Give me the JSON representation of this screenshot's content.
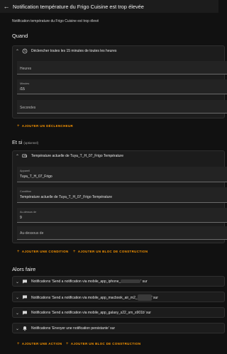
{
  "header": {
    "title": "Notification température du Frigo Cuisine est trop élevée"
  },
  "description": "Notification température du Frigo Cuisine est trop élevé",
  "quand": {
    "title": "Quand",
    "trigger": {
      "label": "Déclencher toutes les 15 minutes de toutes les heures",
      "hours_placeholder": "Heures",
      "minutes_label": "Minutes",
      "minutes_value": "/15",
      "seconds_placeholder": "Secondes"
    },
    "add_trigger": "AJOUTER UN DÉCLENCHEUR"
  },
  "et_si": {
    "title": "Et si",
    "optional": "(optionnel)",
    "condition": {
      "label": "Température actuelle de Tuya_T_H_07_Frigo Température",
      "device_label": "Appareil",
      "device_value": "Tuya_T_H_07_Frigo",
      "entity_label": "Condition",
      "entity_value": "Température actuelle de Tuya_T_H_07_Frigo Température",
      "above_label": "Au-dessus de",
      "above_value": "9",
      "below_placeholder": "Au-dessous de"
    },
    "add_condition": "AJOUTER UNE CONDITION",
    "add_block": "AJOUTER UN BLOC DE CONSTRUCTION"
  },
  "alors_faire": {
    "title": "Alors faire",
    "actions": [
      {
        "prefix": "Notifications 'Send a notification via mobile_app_iphone_",
        "suffix": "' sur"
      },
      {
        "prefix": "Notifications 'Send a notification via mobile_app_macbook_air_m2_",
        "suffix": "' sur"
      },
      {
        "prefix": "Notifications 'Send a notification via mobile_app_galaxy_s22_sm_s901b' sur",
        "suffix": ""
      },
      {
        "prefix": "Notifications 'Envoyer une notification persistante' sur",
        "suffix": ""
      }
    ],
    "add_action": "AJOUTER UNE ACTION",
    "add_block": "AJOUTER UN BLOC DE CONSTRUCTION"
  },
  "icons": {
    "back": "arrow-back-icon",
    "trigger": "clock-icon",
    "condition": "thermometer-display-icon",
    "action": "message-icon",
    "persistent": "bell-message-icon",
    "expand": "chevron-down-icon"
  },
  "colors": {
    "accent": "#ff9800",
    "background": "#111111",
    "card": "#1c1c1c"
  }
}
